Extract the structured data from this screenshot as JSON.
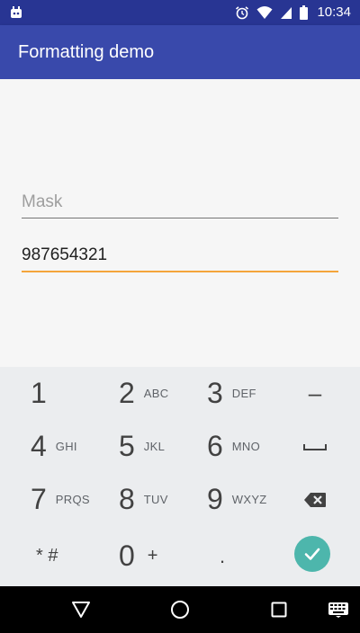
{
  "status_bar": {
    "time": "10:34",
    "icons": [
      "android-debug-icon",
      "alarm-icon",
      "wifi-icon",
      "signal-icon",
      "battery-icon"
    ]
  },
  "app_bar": {
    "title": "Formatting demo"
  },
  "form": {
    "mask_field": {
      "placeholder": "Mask",
      "value": ""
    },
    "number_field": {
      "value": "987654321"
    }
  },
  "keypad": {
    "keys": [
      {
        "digit": "1",
        "letters": ""
      },
      {
        "digit": "2",
        "letters": "ABC"
      },
      {
        "digit": "3",
        "letters": "DEF"
      },
      {
        "digit": "4",
        "letters": "GHI"
      },
      {
        "digit": "5",
        "letters": "JKL"
      },
      {
        "digit": "6",
        "letters": "MNO"
      },
      {
        "digit": "7",
        "letters": "PRQS"
      },
      {
        "digit": "8",
        "letters": "TUV"
      },
      {
        "digit": "9",
        "letters": "WXYZ"
      },
      {
        "digit": "0",
        "letters": "+"
      }
    ],
    "minus_label": "–",
    "star_hash_label": "* #",
    "dot_label": ".",
    "space_icon": "space-icon",
    "backspace_icon": "backspace-icon",
    "done_icon": "check-icon"
  },
  "nav_bar": {
    "icons": [
      "back-icon",
      "home-icon",
      "recents-icon",
      "keyboard-icon"
    ]
  },
  "colors": {
    "status_bar": "#283593",
    "app_bar": "#3949ab",
    "accent": "#f4a53b",
    "done_button": "#4db6ac"
  }
}
